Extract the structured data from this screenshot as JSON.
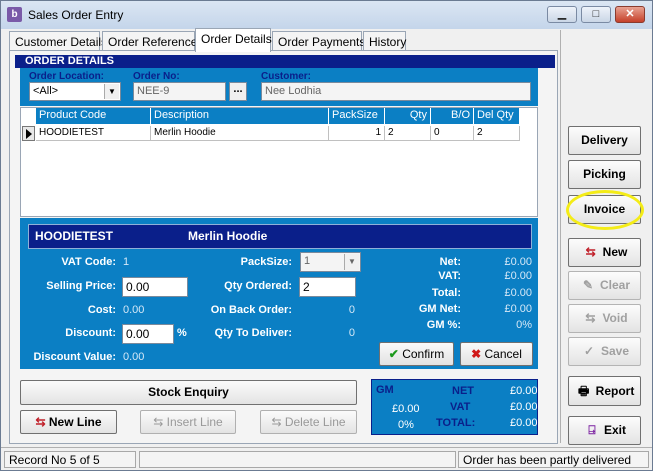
{
  "window": {
    "title": "Sales Order Entry",
    "app_icon_letter": "b",
    "controls": {
      "minimize": "▁",
      "maximize": "□",
      "close": "✕"
    }
  },
  "tabs": [
    {
      "label": "Customer Details"
    },
    {
      "label": "Order Reference"
    },
    {
      "label": "Order Details",
      "active": true
    },
    {
      "label": "Order Payments"
    },
    {
      "label": "History"
    }
  ],
  "order_details": {
    "header": "ORDER DETAILS",
    "location_label": "Order Location:",
    "location_value": "<All>",
    "order_no_label": "Order No:",
    "order_no_value": "NEE-9",
    "lookup_button": "...",
    "customer_label": "Customer:",
    "customer_value": "Nee Lodhia"
  },
  "grid": {
    "columns": [
      "Product Code",
      "Description",
      "PackSize",
      "Qty",
      "B/O",
      "Del Qty"
    ],
    "rows": [
      {
        "product_code": "HOODIETEST",
        "description": "Merlin Hoodie",
        "packsize": "1",
        "qty": "2",
        "bo": "0",
        "del_qty": "2"
      }
    ]
  },
  "item": {
    "code": "HOODIETEST",
    "name": "Merlin Hoodie",
    "vat_code_label": "VAT Code:",
    "vat_code_value": "1",
    "selling_price_label": "Selling Price:",
    "selling_price_value": "0.00",
    "cost_label": "Cost:",
    "cost_value": "0.00",
    "discount_label": "Discount:",
    "discount_value": "0.00",
    "discount_unit": "%",
    "discount_value_label": "Discount Value:",
    "discount_value_value": "0.00",
    "packsize_label": "PackSize:",
    "packsize_value": "1",
    "qty_ordered_label": "Qty Ordered:",
    "qty_ordered_value": "2",
    "on_back_order_label": "On Back Order:",
    "on_back_order_value": "0",
    "qty_to_deliver_label": "Qty To Deliver:",
    "qty_to_deliver_value": "0",
    "net_label": "Net:",
    "net_value": "£0.00",
    "vat_label": "VAT:",
    "vat_value": "£0.00",
    "total_label": "Total:",
    "total_value": "£0.00",
    "gm_net_label": "GM Net:",
    "gm_net_value": "£0.00",
    "gm_pct_label": "GM %:",
    "gm_pct_value": "0%",
    "confirm_label": "Confirm",
    "cancel_label": "Cancel"
  },
  "bottom": {
    "stock_enquiry": "Stock Enquiry",
    "new_line": "New Line",
    "insert_line": "Insert Line",
    "delete_line": "Delete Line"
  },
  "totals": {
    "gm_label": "GM",
    "gm_value": "£0.00",
    "gm_pct": "0%",
    "net_label": "NET",
    "net_value": "£0.00",
    "vat_label": "VAT",
    "vat_value": "£0.00",
    "total_label": "TOTAL:",
    "total_value": "£0.00"
  },
  "side": {
    "delivery": "Delivery",
    "picking": "Picking",
    "invoice": "Invoice",
    "new": "New",
    "clear": "Clear",
    "void": "Void",
    "save": "Save",
    "report": "Report",
    "exit": "Exit"
  },
  "status": {
    "record": "Record No 5 of 5",
    "message": "Order has been partly delivered"
  },
  "colors": {
    "panel_blue": "#0b7fc4",
    "header_navy": "#0a1f8a",
    "highlight": "#f4ec17"
  }
}
